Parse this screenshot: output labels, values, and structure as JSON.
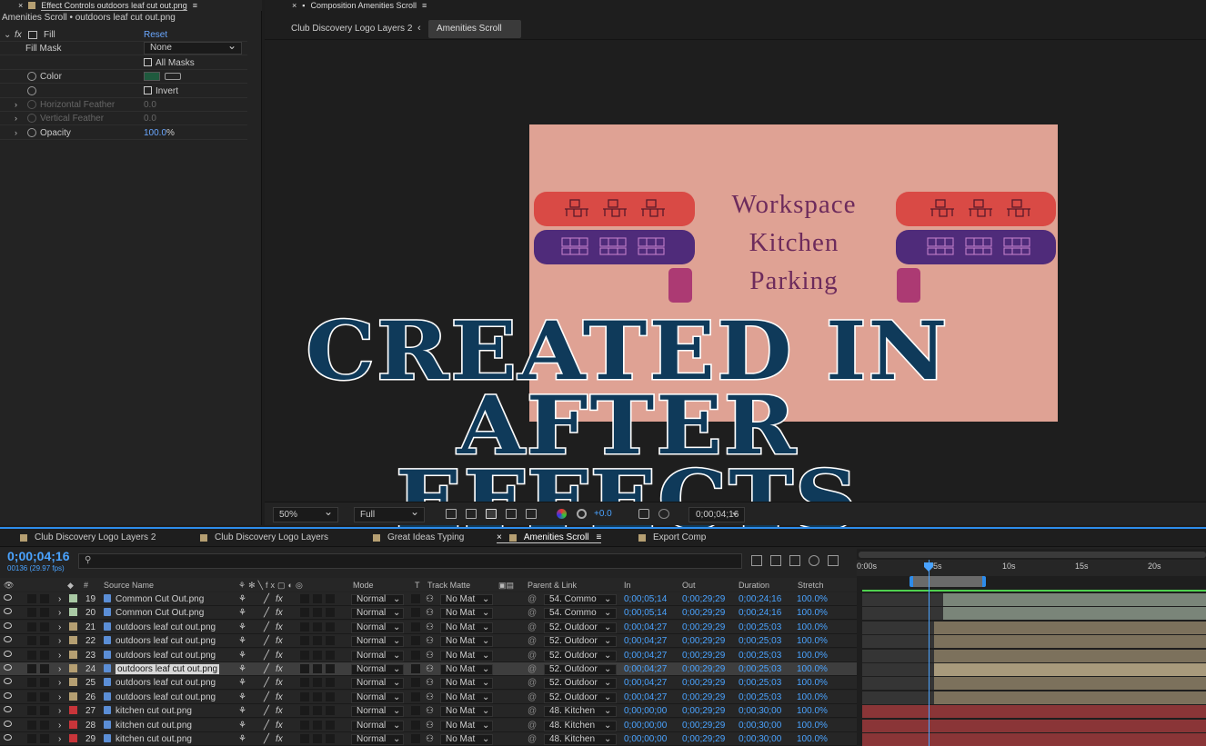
{
  "effect_controls": {
    "tab_title": "Effect Controls outdoors leaf cut out.png",
    "subtitle": "Amenities Scroll • outdoors leaf cut out.png",
    "effect_name": "Fill",
    "reset_label": "Reset",
    "fill_mask_label": "Fill Mask",
    "fill_mask_value": "None",
    "all_masks_label": "All Masks",
    "color_label": "Color",
    "color_value": "#1f5a3e",
    "invert_label": "Invert",
    "h_feather_label": "Horizontal Feather",
    "h_feather_value": "0.0",
    "v_feather_label": "Vertical Feather",
    "v_feather_value": "0.0",
    "opacity_label": "Opacity",
    "opacity_value": "100.0",
    "opacity_unit": "%"
  },
  "composition": {
    "tab_title": "Composition Amenities Scroll",
    "crumbs": [
      "Club Discovery Logo Layers 2",
      "Amenities Scroll"
    ],
    "amenities": [
      "Workspace",
      "Kitchen",
      "Parking"
    ],
    "overlay_line1": "CREATED IN",
    "overlay_line2": "AFTER EFFECTS",
    "zoom": "50%",
    "resolution": "Full",
    "exposure": "+0.0",
    "timecode": "0;00;04;16"
  },
  "timeline": {
    "tabs": [
      "Club Discovery Logo Layers 2",
      "Club Discovery Logo Layers",
      "Great Ideas Typing",
      "Amenities Scroll",
      "Export Comp"
    ],
    "timecode": "0;00;04;16",
    "fps": "00136 (29.97 fps)",
    "headers": {
      "source": "Source Name",
      "mode": "Mode",
      "t": "T",
      "track_matte": "Track Matte",
      "parent": "Parent & Link",
      "in": "In",
      "out": "Out",
      "duration": "Duration",
      "stretch": "Stretch"
    },
    "ruler": [
      "0:00s",
      "5s",
      "10s",
      "15s",
      "20s"
    ],
    "layers": [
      {
        "num": "19",
        "name": "Common Cut Out.png",
        "color": "#a9c9a4",
        "mode": "Normal",
        "matte": "No Mat",
        "parent": "54. Commo",
        "in": "0;00;05;14",
        "out": "0;00;29;29",
        "dur": "0;00;24;16",
        "stretch": "100.0%"
      },
      {
        "num": "20",
        "name": "Common Cut Out.png",
        "color": "#a9c9a4",
        "mode": "Normal",
        "matte": "No Mat",
        "parent": "54. Commo",
        "in": "0;00;05;14",
        "out": "0;00;29;29",
        "dur": "0;00;24;16",
        "stretch": "100.0%"
      },
      {
        "num": "21",
        "name": "outdoors leaf cut out.png",
        "color": "#b59f72",
        "mode": "Normal",
        "matte": "No Mat",
        "parent": "52. Outdoor",
        "in": "0;00;04;27",
        "out": "0;00;29;29",
        "dur": "0;00;25;03",
        "stretch": "100.0%"
      },
      {
        "num": "22",
        "name": "outdoors leaf cut out.png",
        "color": "#b59f72",
        "mode": "Normal",
        "matte": "No Mat",
        "parent": "52. Outdoor",
        "in": "0;00;04;27",
        "out": "0;00;29;29",
        "dur": "0;00;25;03",
        "stretch": "100.0%"
      },
      {
        "num": "23",
        "name": "outdoors leaf cut out.png",
        "color": "#b59f72",
        "mode": "Normal",
        "matte": "No Mat",
        "parent": "52. Outdoor",
        "in": "0;00;04;27",
        "out": "0;00;29;29",
        "dur": "0;00;25;03",
        "stretch": "100.0%"
      },
      {
        "num": "24",
        "name": "outdoors leaf cut out.png",
        "color": "#b59f72",
        "mode": "Normal",
        "matte": "No Mat",
        "parent": "52. Outdoor",
        "in": "0;00;04;27",
        "out": "0;00;29;29",
        "dur": "0;00;25;03",
        "stretch": "100.0%",
        "selected": true
      },
      {
        "num": "25",
        "name": "outdoors leaf cut out.png",
        "color": "#b59f72",
        "mode": "Normal",
        "matte": "No Mat",
        "parent": "52. Outdoor",
        "in": "0;00;04;27",
        "out": "0;00;29;29",
        "dur": "0;00;25;03",
        "stretch": "100.0%"
      },
      {
        "num": "26",
        "name": "outdoors leaf cut out.png",
        "color": "#b59f72",
        "mode": "Normal",
        "matte": "No Mat",
        "parent": "52. Outdoor",
        "in": "0;00;04;27",
        "out": "0;00;29;29",
        "dur": "0;00;25;03",
        "stretch": "100.0%"
      },
      {
        "num": "27",
        "name": "kitchen cut out.png",
        "color": "#c8353a",
        "mode": "Normal",
        "matte": "No Mat",
        "parent": "48. Kitchen",
        "in": "0;00;00;00",
        "out": "0;00;29;29",
        "dur": "0;00;30;00",
        "stretch": "100.0%"
      },
      {
        "num": "28",
        "name": "kitchen cut out.png",
        "color": "#c8353a",
        "mode": "Normal",
        "matte": "No Mat",
        "parent": "48. Kitchen",
        "in": "0;00;00;00",
        "out": "0;00;29;29",
        "dur": "0;00;30;00",
        "stretch": "100.0%"
      },
      {
        "num": "29",
        "name": "kitchen cut out.png",
        "color": "#c8353a",
        "mode": "Normal",
        "matte": "No Mat",
        "parent": "48. Kitchen",
        "in": "0;00;00;00",
        "out": "0;00;29;29",
        "dur": "0;00;30;00",
        "stretch": "100.0%"
      }
    ]
  }
}
